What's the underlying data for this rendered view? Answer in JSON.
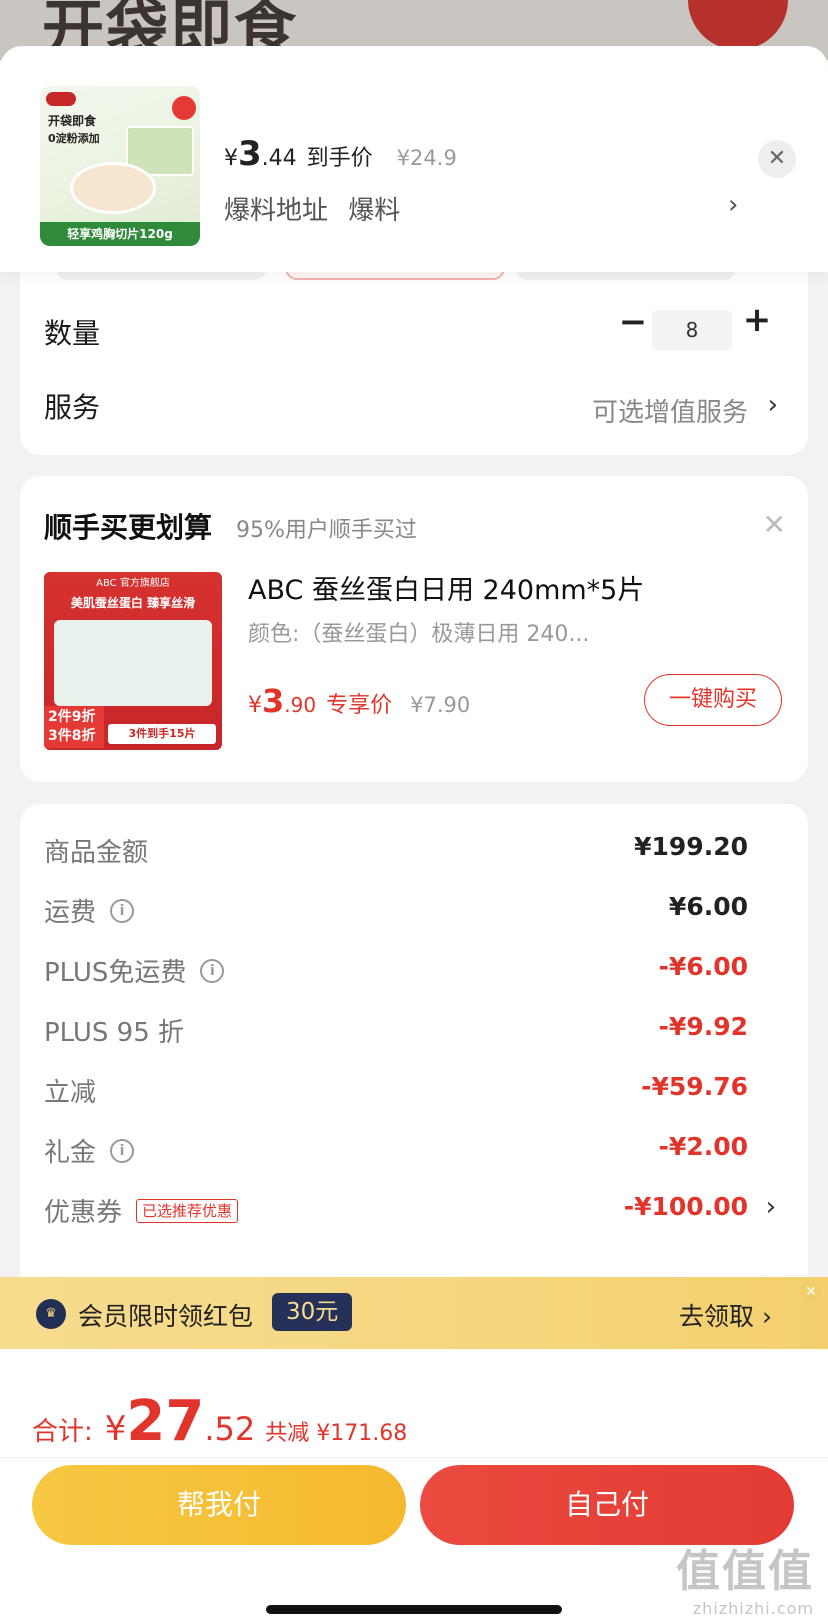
{
  "background": {
    "text": "开袋即食"
  },
  "product": {
    "thumb": {
      "line1": "开袋即食",
      "line2": "0淀粉添加",
      "bar": "轻享鸡胸切片120g"
    },
    "price_yen": "¥",
    "price_int": "3",
    "price_dec": ".44",
    "price_label": "到手价",
    "original_price": "¥24.9",
    "tip_a": "爆料地址",
    "tip_b": "爆料",
    "tip_arrow": "›",
    "close": "✕"
  },
  "spec": {
    "quantity_label": "数量",
    "quantity_minus": "−",
    "quantity_value": "8",
    "quantity_plus": "+",
    "service_label": "服务",
    "service_value": "可选增值服务",
    "service_arrow": "›"
  },
  "upsell": {
    "title": "顺手买更划算",
    "subtitle": "95%用户顺手买过",
    "close": "✕",
    "image": {
      "top": "ABC 官方旗舰店",
      "headline": "美肌蚕丝蛋白 臻享丝滑",
      "badge1": "2件9折",
      "badge2": "3件8折",
      "bottom": "3件到手15片"
    },
    "name": "ABC 蚕丝蛋白日用 240mm*5片",
    "spec": "颜色:（蚕丝蛋白）极薄日用 240...",
    "price_yen": "¥",
    "price_int": "3",
    "price_dec": ".90",
    "price_label": "专享价",
    "original_price": "¥7.90",
    "buy_label": "一键购买"
  },
  "fees": {
    "rows": [
      {
        "label": "商品金额",
        "value": "¥199.20"
      },
      {
        "label": "运费",
        "value": "¥6.00"
      },
      {
        "label": "PLUS免运费",
        "value": "-¥6.00"
      },
      {
        "label": "PLUS 95 折",
        "value": "-¥9.92"
      },
      {
        "label": "立减",
        "value": "-¥59.76"
      },
      {
        "label": "礼金",
        "value": "-¥2.00"
      },
      {
        "label": "优惠券",
        "tag": "已选推荐优惠",
        "value": "-¥100.00"
      }
    ],
    "arrow": "›",
    "info_icon": "i"
  },
  "banner": {
    "text": "会员限时领红包",
    "amount": "30元",
    "action": "去领取 ›",
    "close": "✕"
  },
  "footer": {
    "total_label": "合计:",
    "total_yen": "¥",
    "total_int": "27",
    "total_dec": ".52",
    "total_save": "共减 ¥171.68",
    "help_pay": "帮我付",
    "self_pay": "自己付"
  },
  "watermark": {
    "logo": "值值值",
    "url": "zhizhizhi.com"
  },
  "colors": {
    "accent_red": "#e1352c",
    "yellow": "#f7c842",
    "navy": "#26315a"
  }
}
